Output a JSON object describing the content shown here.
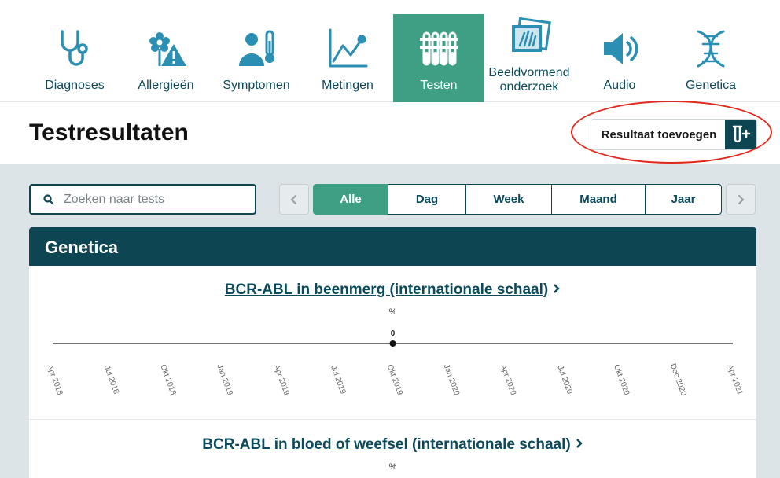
{
  "nav": [
    {
      "label": "Diagnoses",
      "icon": "stethoscope-icon"
    },
    {
      "label": "Allergieën",
      "icon": "allergy-flower-warning-icon"
    },
    {
      "label": "Symptomen",
      "icon": "patient-thermometer-icon"
    },
    {
      "label": "Metingen",
      "icon": "line-graph-icon"
    },
    {
      "label": "Testen",
      "icon": "test-tubes-icon",
      "active": true
    },
    {
      "label": "Beeldvormend onderzoek",
      "icon": "xray-images-icon"
    },
    {
      "label": "Audio",
      "icon": "speaker-icon"
    },
    {
      "label": "Genetica",
      "icon": "dna-icon"
    }
  ],
  "header": {
    "title": "Testresultaten",
    "add_button_label": "Resultaat toevoegen",
    "add_button_icon": "add-test-tube-icon"
  },
  "filters": {
    "search_placeholder": "Zoeken naar tests",
    "segments": [
      "Alle",
      "Dag",
      "Week",
      "Maand",
      "Jaar"
    ],
    "active_segment": "Alle"
  },
  "section": {
    "title": "Genetica",
    "charts": [
      {
        "title": "BCR-ABL in beenmerg (internationale schaal)",
        "unit": "%",
        "chart_data": {
          "type": "line",
          "x_ticks": [
            "Apr 2018",
            "Jul 2018",
            "Okt 2018",
            "Jan 2019",
            "Apr 2019",
            "Jul 2019",
            "Okt 2019",
            "Jan 2020",
            "Apr 2020",
            "Jul 2020",
            "Okt 2020",
            "Dec 2020",
            "Apr 2021"
          ],
          "points": [
            {
              "x": "Okt 2019",
              "y": 0,
              "label": "0"
            }
          ]
        }
      },
      {
        "title": "BCR-ABL in bloed of weefsel (internationale schaal)",
        "unit": "%"
      }
    ]
  },
  "colors": {
    "brand_dark": "#0d4652",
    "accent_green": "#3f9f84",
    "annotation_red": "#e02a1e"
  }
}
